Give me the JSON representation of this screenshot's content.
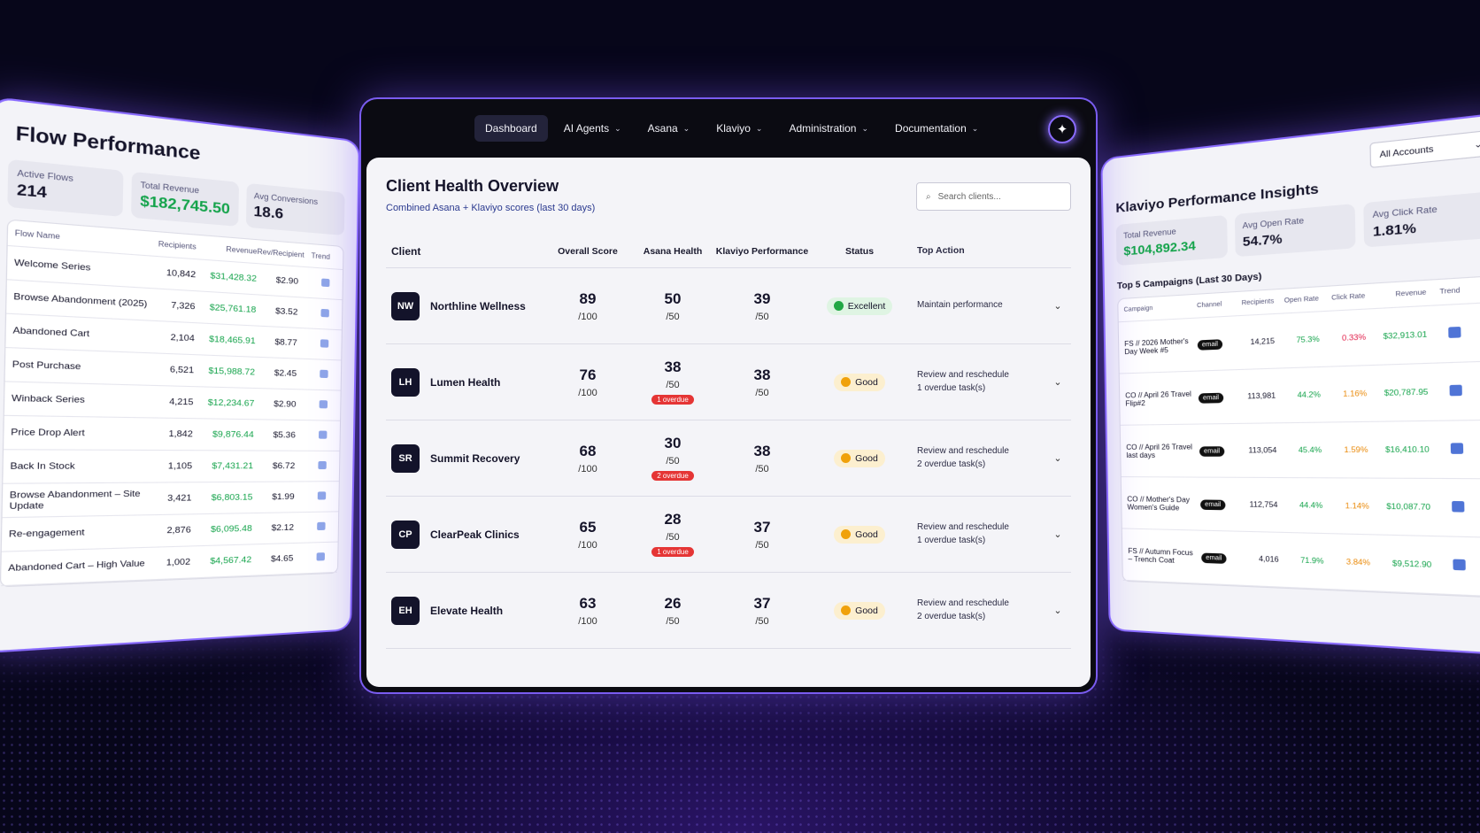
{
  "nav": {
    "items": [
      {
        "label": "Dashboard",
        "dropdown": false
      },
      {
        "label": "AI Agents",
        "dropdown": true
      },
      {
        "label": "Asana",
        "dropdown": true
      },
      {
        "label": "Klaviyo",
        "dropdown": true
      },
      {
        "label": "Administration",
        "dropdown": true
      },
      {
        "label": "Documentation",
        "dropdown": true
      }
    ],
    "logo_icon": "sparkle-icon"
  },
  "center": {
    "title": "Client Health Overview",
    "subtitle": "Combined Asana + Klaviyo scores (last 30 days)",
    "search_placeholder": "Search clients...",
    "columns": [
      "Client",
      "Overall Score",
      "Asana Health",
      "Klaviyo Performance",
      "Status",
      "Top Action"
    ],
    "rows": [
      {
        "initials": "NW",
        "name": "Northline Wellness",
        "overall": "89",
        "overall_max": "/100",
        "asana": "50",
        "asana_max": "/50",
        "badge": "",
        "klaviyo": "39",
        "klaviyo_max": "/50",
        "status": "Excellent",
        "status_color": "#22a745",
        "action1": "Maintain performance",
        "action2": ""
      },
      {
        "initials": "LH",
        "name": "Lumen Health",
        "overall": "76",
        "overall_max": "/100",
        "asana": "38",
        "asana_max": "/50",
        "badge": "1 overdue",
        "klaviyo": "38",
        "klaviyo_max": "/50",
        "status": "Good",
        "status_color": "#f0a10a",
        "action1": "Review and reschedule",
        "action2": "1 overdue task(s)"
      },
      {
        "initials": "SR",
        "name": "Summit Recovery",
        "overall": "68",
        "overall_max": "/100",
        "asana": "30",
        "asana_max": "/50",
        "badge": "2 overdue",
        "klaviyo": "38",
        "klaviyo_max": "/50",
        "status": "Good",
        "status_color": "#f0a10a",
        "action1": "Review and reschedule",
        "action2": "2 overdue task(s)"
      },
      {
        "initials": "CP",
        "name": "ClearPeak Clinics",
        "overall": "65",
        "overall_max": "/100",
        "asana": "28",
        "asana_max": "/50",
        "badge": "1 overdue",
        "klaviyo": "37",
        "klaviyo_max": "/50",
        "status": "Good",
        "status_color": "#f0a10a",
        "action1": "Review and reschedule",
        "action2": "1 overdue task(s)"
      },
      {
        "initials": "EH",
        "name": "Elevate Health",
        "overall": "63",
        "overall_max": "/100",
        "asana": "26",
        "asana_max": "/50",
        "badge": "",
        "klaviyo": "37",
        "klaviyo_max": "/50",
        "status": "Good",
        "status_color": "#f0a10a",
        "action1": "Review and reschedule",
        "action2": "2 overdue task(s)"
      }
    ]
  },
  "left": {
    "title": "Flow Performance",
    "stats": [
      {
        "label": "Active Flows",
        "value": "214"
      },
      {
        "label": "Total Revenue",
        "value": "$182,745.50"
      },
      {
        "label": "Avg Conversions",
        "value": "18.6"
      }
    ],
    "columns": [
      "Flow Name",
      "Recipients",
      "Revenue",
      "Rev/Recipient",
      "Trend"
    ],
    "rows": [
      {
        "name": "Welcome Series",
        "recipients": "10,842",
        "revenue": "$31,428.32",
        "rpr": "$2.90"
      },
      {
        "name": "Browse Abandonment (2025)",
        "recipients": "7,326",
        "revenue": "$25,761.18",
        "rpr": "$3.52"
      },
      {
        "name": "Abandoned Cart",
        "recipients": "2,104",
        "revenue": "$18,465.91",
        "rpr": "$8.77"
      },
      {
        "name": "Post Purchase",
        "recipients": "6,521",
        "revenue": "$15,988.72",
        "rpr": "$2.45"
      },
      {
        "name": "Winback Series",
        "recipients": "4,215",
        "revenue": "$12,234.67",
        "rpr": "$2.90"
      },
      {
        "name": "Price Drop Alert",
        "recipients": "1,842",
        "revenue": "$9,876.44",
        "rpr": "$5.36"
      },
      {
        "name": "Back In Stock",
        "recipients": "1,105",
        "revenue": "$7,431.21",
        "rpr": "$6.72"
      },
      {
        "name": "Browse Abandonment – Site Update",
        "recipients": "3,421",
        "revenue": "$6,803.15",
        "rpr": "$1.99"
      },
      {
        "name": "Re-engagement",
        "recipients": "2,876",
        "revenue": "$6,095.48",
        "rpr": "$2.12"
      },
      {
        "name": "Abandoned Cart – High Value",
        "recipients": "1,002",
        "revenue": "$4,567.42",
        "rpr": "$4.65"
      }
    ]
  },
  "right": {
    "title": "Klaviyo Performance Insights",
    "account_select": "All Accounts",
    "stats": [
      {
        "label": "Total Revenue",
        "value": "$104,892.34"
      },
      {
        "label": "Avg Open Rate",
        "value": "54.7%"
      },
      {
        "label": "Avg Click Rate",
        "value": "1.81%"
      }
    ],
    "section": "Top 5 Campaigns (Last 30 Days)",
    "columns": [
      "Campaign",
      "Channel",
      "Recipients",
      "Open Rate",
      "Click Rate",
      "Revenue",
      "Trend"
    ],
    "rows": [
      {
        "name": "FS // 2026 Mother's Day Week #5",
        "channel": "email",
        "recipients": "14,215",
        "open": "75.3%",
        "click": "0.33%",
        "click_color": "#e11d48",
        "revenue": "$32,913.01"
      },
      {
        "name": "CO // April 26 Travel Flip#2",
        "channel": "email",
        "recipients": "113,981",
        "open": "44.2%",
        "click": "1.16%",
        "click_color": "#ea8a0a",
        "revenue": "$20,787.95"
      },
      {
        "name": "CO // April 26 Travel last days",
        "channel": "email",
        "recipients": "113,054",
        "open": "45.4%",
        "click": "1.59%",
        "click_color": "#ea8a0a",
        "revenue": "$16,410.10"
      },
      {
        "name": "CO // Mother's Day Women's Guide",
        "channel": "email",
        "recipients": "112,754",
        "open": "44.4%",
        "click": "1.14%",
        "click_color": "#ea8a0a",
        "revenue": "$10,087.70"
      },
      {
        "name": "FS // Autumn Focus – Trench Coat",
        "channel": "email",
        "recipients": "4,016",
        "open": "71.9%",
        "click": "3.84%",
        "click_color": "#ea8a0a",
        "revenue": "$9,512.90"
      }
    ]
  }
}
